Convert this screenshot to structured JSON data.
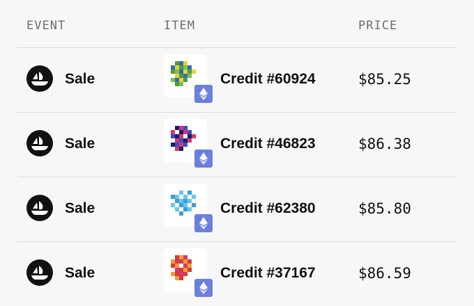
{
  "header": {
    "event": "EVENT",
    "item": "ITEM",
    "price": "PRICE"
  },
  "rows": [
    {
      "event": "Sale",
      "item": "Credit #60924",
      "price": "$85.25",
      "event_icon": "opensea-ship-icon",
      "badge_icon": "ethereum-icon"
    },
    {
      "event": "Sale",
      "item": "Credit #46823",
      "price": "$86.38",
      "event_icon": "opensea-ship-icon",
      "badge_icon": "ethereum-icon"
    },
    {
      "event": "Sale",
      "item": "Credit #62380",
      "price": "$85.80",
      "event_icon": "opensea-ship-icon",
      "badge_icon": "ethereum-icon"
    },
    {
      "event": "Sale",
      "item": "Credit #37167",
      "price": "$86.59",
      "event_icon": "opensea-ship-icon",
      "badge_icon": "ethereum-icon"
    }
  ],
  "colors": {
    "background": "#f7f7f7",
    "header_text": "#6e6e6e",
    "divider": "#dcdcdc",
    "eth_badge": "#6b7fdc"
  }
}
